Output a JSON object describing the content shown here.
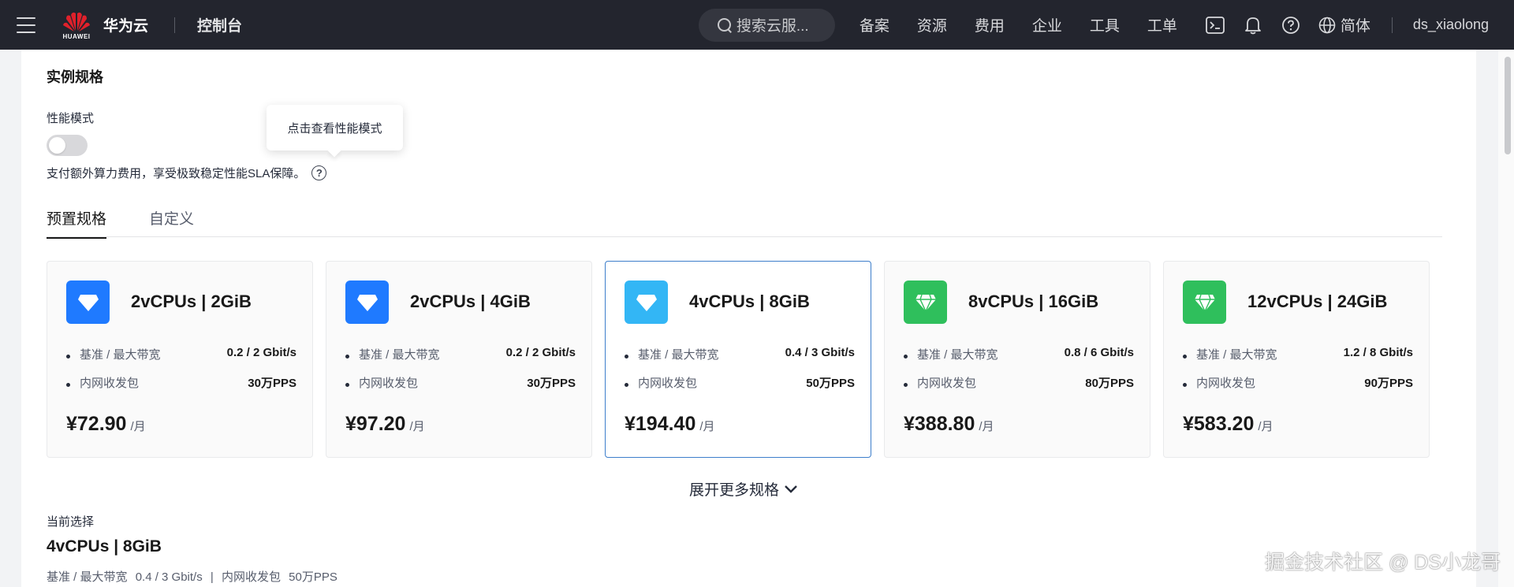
{
  "topbar": {
    "logo_text": "HUAWEI",
    "brand": "华为云",
    "console": "控制台",
    "search_placeholder": "搜索云服...",
    "links": [
      "备案",
      "资源",
      "费用",
      "企业",
      "工具",
      "工单"
    ],
    "language": "简体",
    "username": "ds_xiaolong"
  },
  "main": {
    "section_title": "实例规格",
    "performance_mode": {
      "label": "性能模式",
      "enabled": false,
      "description": "支付额外算力费用，享受极致稳定性能SLA保障。",
      "help_glyph": "?",
      "tooltip": "点击查看性能模式"
    },
    "tabs": [
      {
        "label": "预置规格",
        "active": true
      },
      {
        "label": "自定义",
        "active": false
      }
    ],
    "cards": [
      {
        "name": "2vCPUs | 2GiB",
        "icon": "diamond-icon",
        "icon_color": "#1f7aff",
        "bandwidth_label": "基准 / 最大带宽",
        "bandwidth": "0.2 / 2 Gbit/s",
        "pps_label": "内网收发包",
        "pps": "30万PPS",
        "price": "¥72.90",
        "unit": "/月",
        "selected": false
      },
      {
        "name": "2vCPUs | 4GiB",
        "icon": "diamond-icon",
        "icon_color": "#1f7aff",
        "bandwidth_label": "基准 / 最大带宽",
        "bandwidth": "0.2 / 2 Gbit/s",
        "pps_label": "内网收发包",
        "pps": "30万PPS",
        "price": "¥97.20",
        "unit": "/月",
        "selected": false
      },
      {
        "name": "4vCPUs | 8GiB",
        "icon": "diamond-icon",
        "icon_color": "#33b6f5",
        "bandwidth_label": "基准 / 最大带宽",
        "bandwidth": "0.4 / 3 Gbit/s",
        "pps_label": "内网收发包",
        "pps": "50万PPS",
        "price": "¥194.40",
        "unit": "/月",
        "selected": true
      },
      {
        "name": "8vCPUs | 16GiB",
        "icon": "gem-icon",
        "icon_color": "#2fbf5c",
        "bandwidth_label": "基准 / 最大带宽",
        "bandwidth": "0.8 / 6 Gbit/s",
        "pps_label": "内网收发包",
        "pps": "80万PPS",
        "price": "¥388.80",
        "unit": "/月",
        "selected": false
      },
      {
        "name": "12vCPUs | 24GiB",
        "icon": "gem-icon",
        "icon_color": "#2fbf5c",
        "bandwidth_label": "基准 / 最大带宽",
        "bandwidth": "1.2 / 8 Gbit/s",
        "pps_label": "内网收发包",
        "pps": "90万PPS",
        "price": "¥583.20",
        "unit": "/月",
        "selected": false
      }
    ],
    "expand_label": "展开更多规格",
    "current_selection": {
      "label": "当前选择",
      "name": "4vCPUs | 8GiB",
      "bandwidth_label": "基准 / 最大带宽",
      "bandwidth": "0.4 / 3 Gbit/s",
      "separator": "|",
      "pps_label": "内网收发包",
      "pps": "50万PPS"
    }
  },
  "watermark": "掘金技术社区 @ DS小龙哥"
}
